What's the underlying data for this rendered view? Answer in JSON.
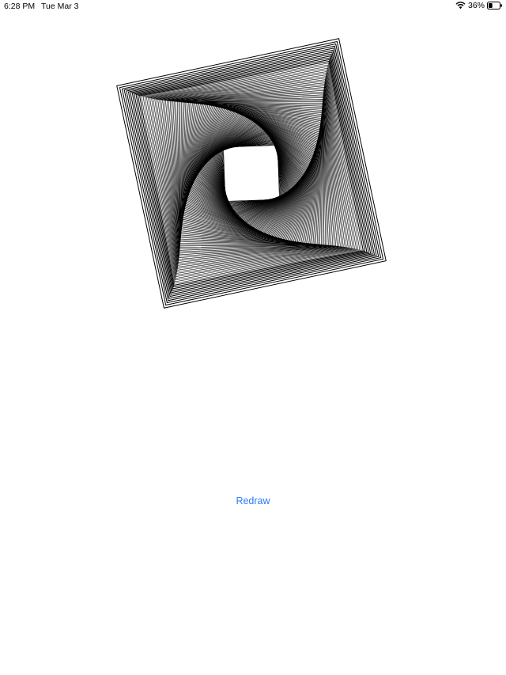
{
  "status_bar": {
    "time": "6:28 PM",
    "date": "Tue Mar 3",
    "battery_percent": "36%",
    "battery_level": 0.36,
    "icons": [
      "wifi-icon",
      "battery-icon"
    ]
  },
  "drawing": {
    "shape": "nested-rotated-squares",
    "stroke_color": "#000000"
  },
  "redraw": {
    "label": "Redraw",
    "color": "#2f7bf5"
  }
}
